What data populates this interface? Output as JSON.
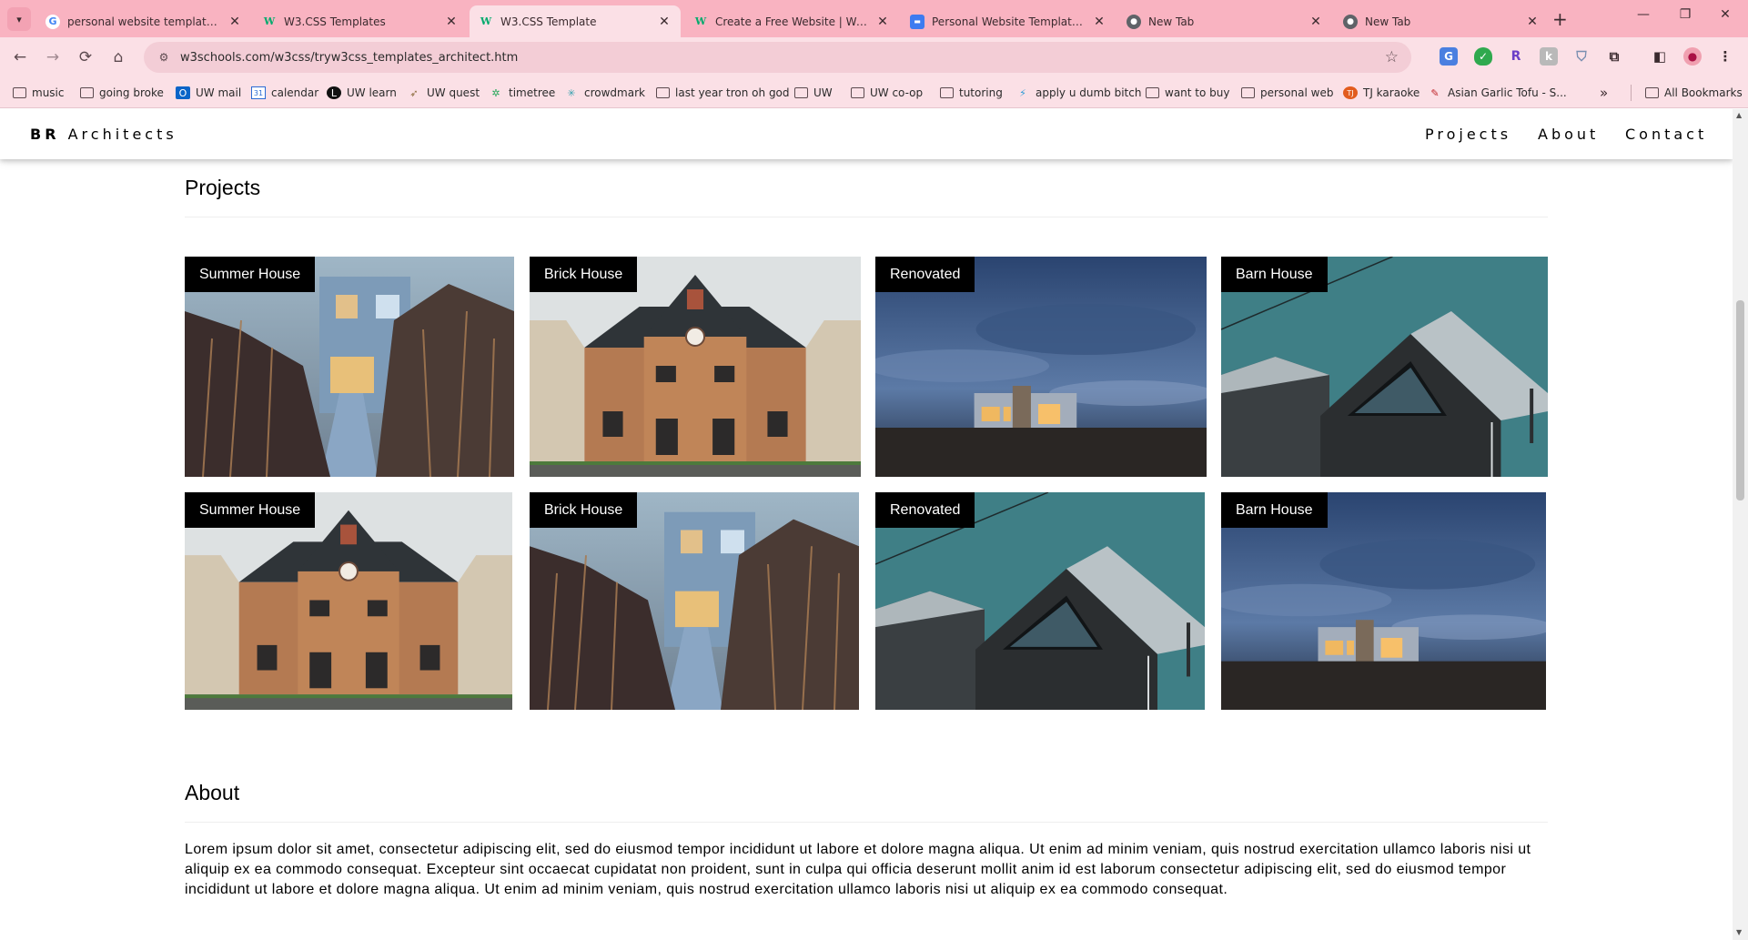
{
  "browser": {
    "tabs": [
      {
        "label": "personal website templates htm",
        "favicon": "google-icon"
      },
      {
        "label": "W3.CSS Templates",
        "favicon": "w3schools-icon"
      },
      {
        "label": "W3.CSS Template",
        "favicon": "w3schools-icon",
        "active": true
      },
      {
        "label": "Create a Free Website | Website",
        "favicon": "w3schools-icon"
      },
      {
        "label": "Personal Website Templates Fre",
        "favicon": "site-icon"
      },
      {
        "label": "New Tab",
        "favicon": "chrome-icon"
      },
      {
        "label": "New Tab",
        "favicon": "chrome-icon"
      }
    ],
    "url": "w3schools.com/w3css/tryw3css_templates_architect.htm",
    "bookmarks": [
      {
        "label": "music",
        "icon": "folder-icon"
      },
      {
        "label": "going broke",
        "icon": "folder-icon"
      },
      {
        "label": "UW mail",
        "icon": "outlook-icon"
      },
      {
        "label": "calendar",
        "icon": "calendar-icon"
      },
      {
        "label": "UW learn",
        "icon": "learn-icon"
      },
      {
        "label": "UW quest",
        "icon": "quest-icon"
      },
      {
        "label": "timetree",
        "icon": "timetree-icon"
      },
      {
        "label": "crowdmark",
        "icon": "crowdmark-icon"
      },
      {
        "label": "last year tron oh god",
        "icon": "folder-icon"
      },
      {
        "label": "UW",
        "icon": "folder-icon"
      },
      {
        "label": "UW co-op",
        "icon": "folder-icon"
      },
      {
        "label": "tutoring",
        "icon": "folder-icon"
      },
      {
        "label": "apply u dumb bitch",
        "icon": "link-icon"
      },
      {
        "label": "want to buy",
        "icon": "folder-icon"
      },
      {
        "label": "personal web",
        "icon": "folder-icon"
      },
      {
        "label": "TJ karaoke",
        "icon": "karaoke-icon"
      },
      {
        "label": "Asian Garlic Tofu - S...",
        "icon": "recipe-icon"
      }
    ],
    "all_bookmarks": "All Bookmarks",
    "more_bookmarks": "»"
  },
  "site": {
    "brand_bold": "BR",
    "brand_rest": "Architects",
    "nav": {
      "projects": "Projects",
      "about": "About",
      "contact": "Contact"
    }
  },
  "projects": {
    "title": "Projects",
    "cards": [
      {
        "label": "Summer House",
        "scene": "summer"
      },
      {
        "label": "Brick House",
        "scene": "brick"
      },
      {
        "label": "Renovated",
        "scene": "renovated"
      },
      {
        "label": "Barn House",
        "scene": "barn"
      },
      {
        "label": "Summer House",
        "scene": "brick"
      },
      {
        "label": "Brick House",
        "scene": "summer"
      },
      {
        "label": "Renovated",
        "scene": "barn"
      },
      {
        "label": "Barn House",
        "scene": "renovated"
      }
    ]
  },
  "about": {
    "title": "About",
    "text": "Lorem ipsum dolor sit amet, consectetur adipiscing elit, sed do eiusmod tempor incididunt ut labore et dolore magna aliqua. Ut enim ad minim veniam, quis nostrud exercitation ullamco laboris nisi ut aliquip ex ea commodo consequat. Excepteur sint occaecat cupidatat non proident, sunt in culpa qui officia deserunt mollit anim id est laborum consectetur adipiscing elit, sed do eiusmod tempor incididunt ut labore et dolore magna aliqua. Ut enim ad minim veniam, quis nostrud exercitation ullamco laboris nisi ut aliquip ex ea commodo consequat."
  },
  "colors": {
    "tabbar": "#f9b3c1",
    "toolbar": "#fbe0e6",
    "label_bg": "#000000"
  }
}
